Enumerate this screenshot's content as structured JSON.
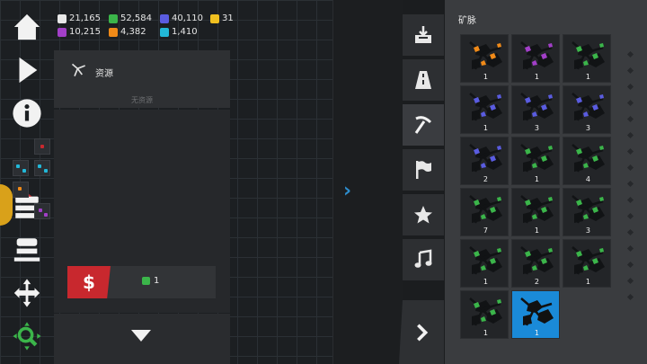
{
  "resources": [
    {
      "name": "res-1",
      "value": "21,165",
      "color": "#e8e8e8"
    },
    {
      "name": "res-2",
      "value": "52,584",
      "color": "#3bb54a"
    },
    {
      "name": "res-3",
      "value": "40,110",
      "color": "#5a5ce0"
    },
    {
      "name": "res-4",
      "value": "31",
      "color": "#f0c020"
    },
    {
      "name": "res-5",
      "value": "10,215",
      "color": "#a23fc8"
    },
    {
      "name": "res-6",
      "value": "4,382",
      "color": "#f08a18"
    },
    {
      "name": "res-7",
      "value": "1,410",
      "color": "#22b8d8"
    }
  ],
  "toolbar": {
    "icons": [
      "home-icon",
      "play-icon",
      "info-icon",
      "tray-stack-icon",
      "move-icon",
      "zoom-search-icon"
    ]
  },
  "info_panel": {
    "title": "资源",
    "empty_text": "无资源",
    "cost_value": "1",
    "buy_symbol": "$"
  },
  "tabs": [
    "download-box-icon",
    "road-icon",
    "pickaxe-icon",
    "flag-icon",
    "star-icon",
    "music-note-icon"
  ],
  "palette": {
    "title": "矿脉",
    "items": [
      {
        "gem": "#f08a18",
        "count": "1"
      },
      {
        "gem": "#a23fc8",
        "count": "1"
      },
      {
        "gem": "#3bb54a",
        "count": "1"
      },
      {
        "gem": "#5a5ce0",
        "count": "1"
      },
      {
        "gem": "#5a5ce0",
        "count": "3"
      },
      {
        "gem": "#5a5ce0",
        "count": "3"
      },
      {
        "gem": "#5a5ce0",
        "count": "2"
      },
      {
        "gem": "#3bb54a",
        "count": "1"
      },
      {
        "gem": "#3bb54a",
        "count": "4"
      },
      {
        "gem": "#3bb54a",
        "count": "7"
      },
      {
        "gem": "#3bb54a",
        "count": "1"
      },
      {
        "gem": "#3bb54a",
        "count": "3"
      },
      {
        "gem": "#3bb54a",
        "count": "1"
      },
      {
        "gem": "#3bb54a",
        "count": "2"
      },
      {
        "gem": "#3bb54a",
        "count": "1"
      },
      {
        "gem": "#3bb54a",
        "count": "1"
      },
      {
        "gem": "#1a1a1a",
        "count": "1",
        "selected": true
      }
    ]
  },
  "colors": {
    "accent": "#1a8ad8",
    "danger": "#c8282e",
    "highlight": "#2d8ccc"
  }
}
